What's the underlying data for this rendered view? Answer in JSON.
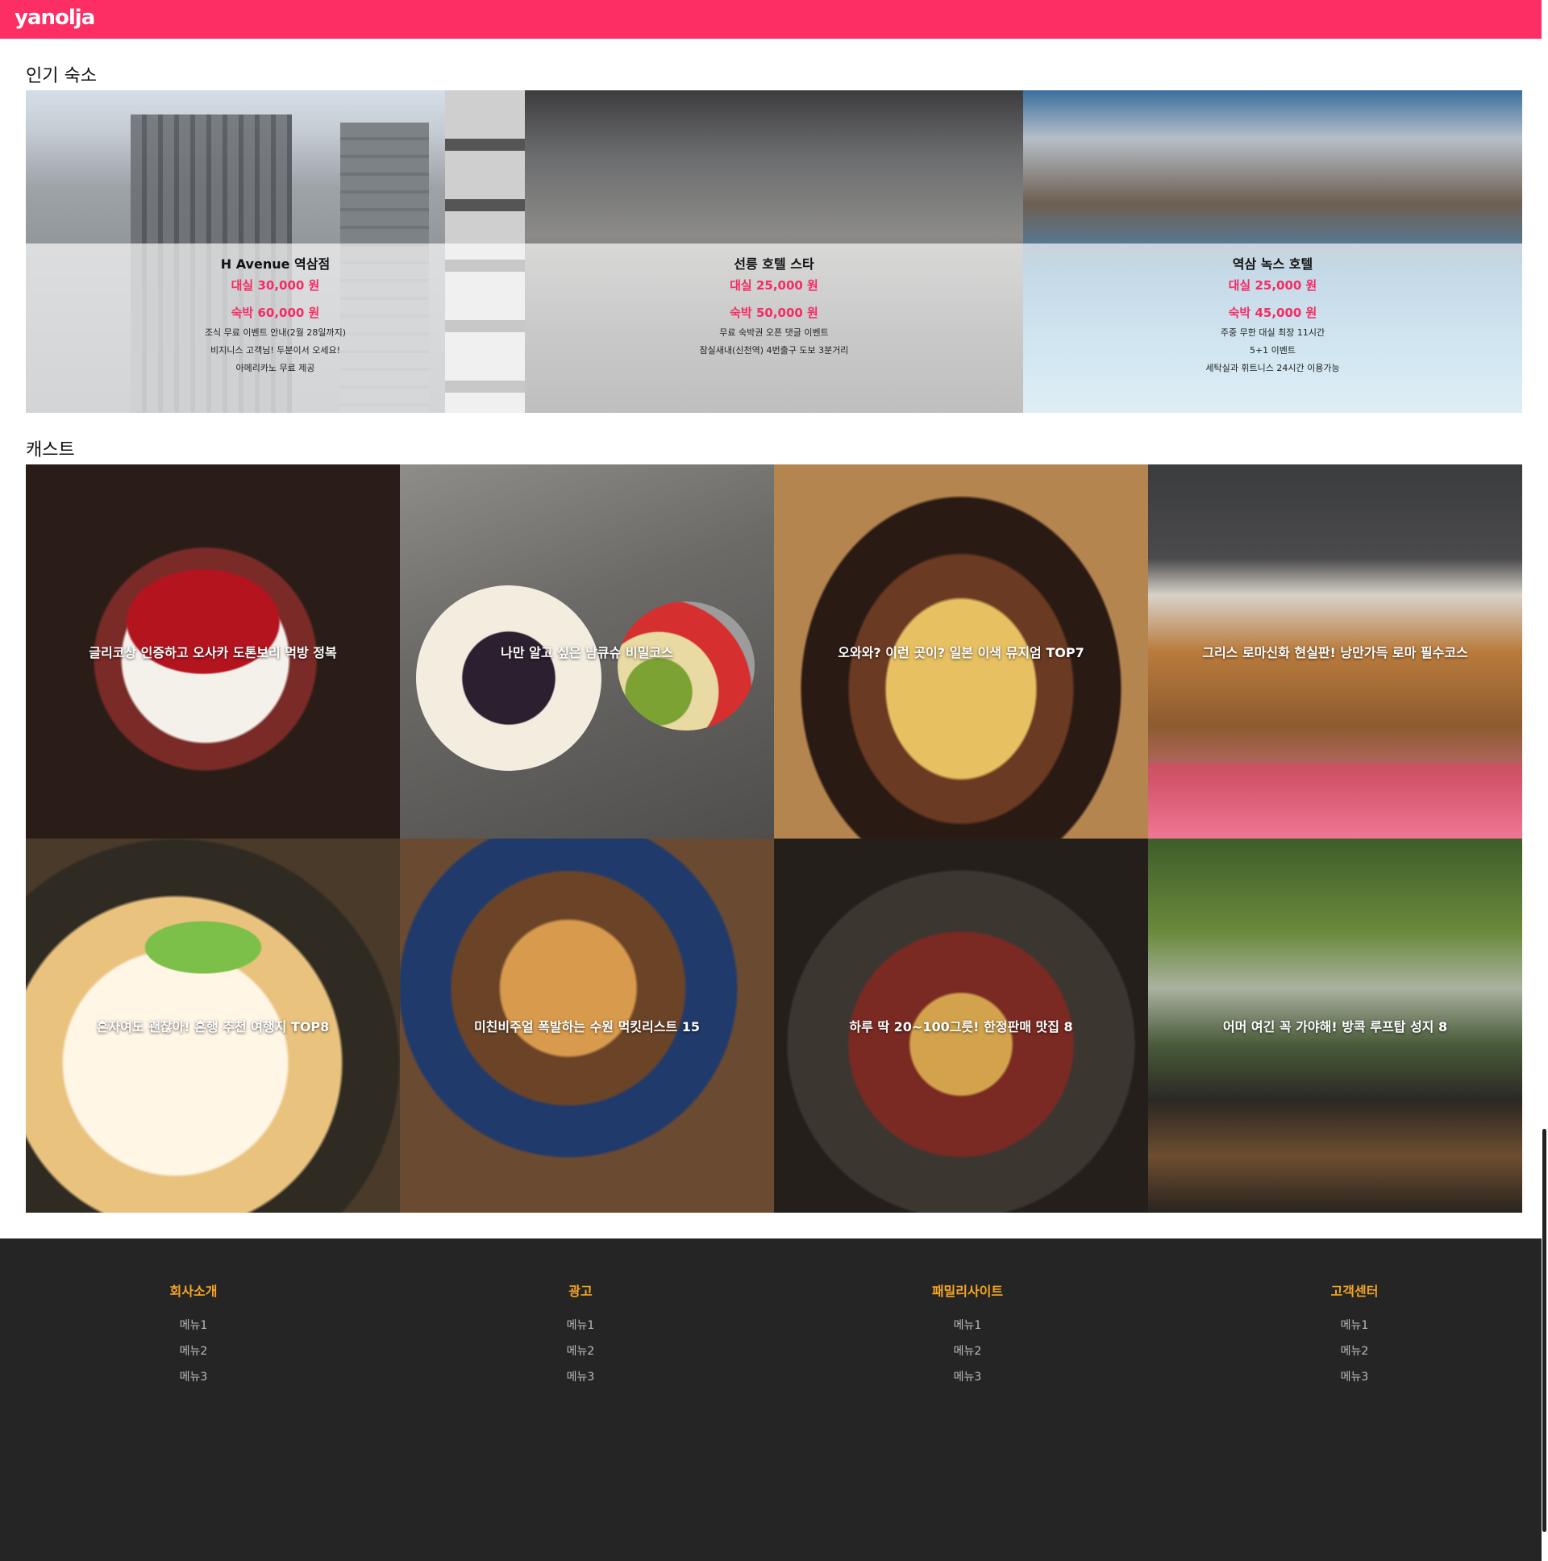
{
  "header": {
    "logo": "yanolja",
    "color": "#fc2e64"
  },
  "sections": {
    "hotels_title": "인기 숙소",
    "casts_title": "캐스트"
  },
  "hotels": [
    {
      "name": "H Avenue 역삼점",
      "day_price": "대실 30,000 원",
      "night_price": "숙박 60,000 원",
      "notes": [
        "조식 무료 이벤트 안내(2월 28일까지)",
        "비지니스 고객님! 두분이서 오세요!",
        "아메리카노 무료 제공"
      ]
    },
    {
      "name": "선릉 호텔 스타",
      "day_price": "대실 25,000 원",
      "night_price": "숙박 50,000 원",
      "notes": [
        "무료 숙박권 오픈 댓글 이벤트",
        "잠실새내(신천역) 4번출구 도보 3분거리"
      ]
    },
    {
      "name": "역삼 녹스 호텔",
      "day_price": "대실 25,000 원",
      "night_price": "숙박 45,000 원",
      "notes": [
        "주중 무한 대실 최장 11시간",
        "5+1 이벤트",
        "세탁실과 휘트니스 24시간 이용가능"
      ]
    }
  ],
  "casts": [
    "글리코상 인증하고 오사카 도톤보리 먹방 정복",
    "나만 알고 싶은 남큐슈 비밀코스",
    "오와와? 이런 곳이? 일본 이색 뮤지엄 TOP7",
    "그리스 로마신화 현실판! 낭만가득 로마 필수코스",
    "혼자여도 괜찮아! 혼행 추천 여행지 TOP8",
    "미친비주얼 폭발하는 수원 먹킷리스트 15",
    "하루 딱 20~100그릇! 한정판매 맛집 8",
    "어머 여긴 꼭 가야해! 방콕 루프탑 성지 8"
  ],
  "footer": {
    "columns": [
      {
        "title": "회사소개",
        "items": [
          "메뉴1",
          "메뉴2",
          "메뉴3"
        ]
      },
      {
        "title": "광고",
        "items": [
          "메뉴1",
          "메뉴2",
          "메뉴3"
        ]
      },
      {
        "title": "패밀리사이트",
        "items": [
          "메뉴1",
          "메뉴2",
          "메뉴3"
        ]
      },
      {
        "title": "고객센터",
        "items": [
          "메뉴1",
          "메뉴2",
          "메뉴3"
        ]
      }
    ],
    "title_color": "#f5a623"
  }
}
